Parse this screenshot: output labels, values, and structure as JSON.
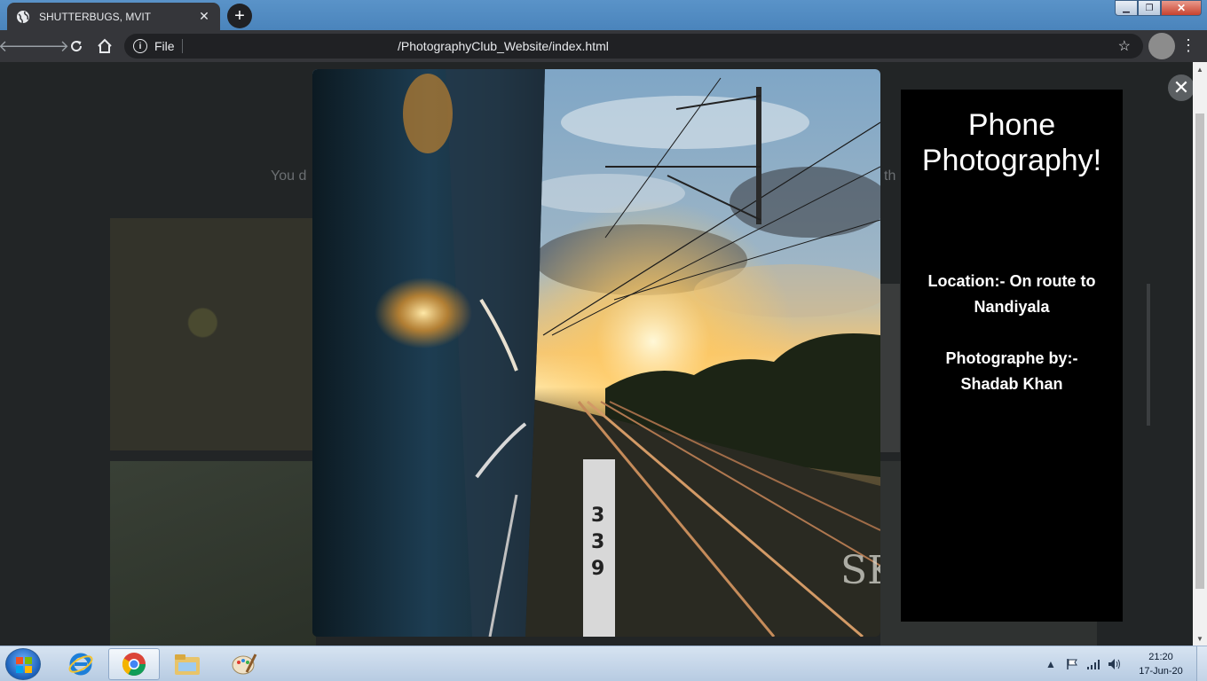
{
  "browser": {
    "tab_title": "SHUTTERBUGS, MVIT",
    "scheme_label": "File",
    "url": "/PhotographyClub_Website/index.html"
  },
  "icons": {
    "tab_favicon": "globe-icon",
    "back": "arrow-left-icon",
    "forward": "arrow-right-icon",
    "reload": "reload-icon",
    "home": "home-icon",
    "site_info": "info-icon",
    "bookmark": "star-icon",
    "menu": "more-vert-icon"
  },
  "page": {
    "background_fragment_left": "You d",
    "background_fragment_right": "th"
  },
  "lightbox": {
    "heading": "Phone Photography!",
    "location_line": "Location:- On route to Nandiyala",
    "photographer_line": "Photographe by:- Shadab Khan",
    "watermark": "SK"
  },
  "taskbar": {
    "time": "21:20",
    "date": "17-Jun-20"
  },
  "colors": {
    "chrome_toolbar": "#35363a",
    "omnibox": "#202124",
    "caption_bg": "#000000",
    "overlay": "#222526"
  }
}
